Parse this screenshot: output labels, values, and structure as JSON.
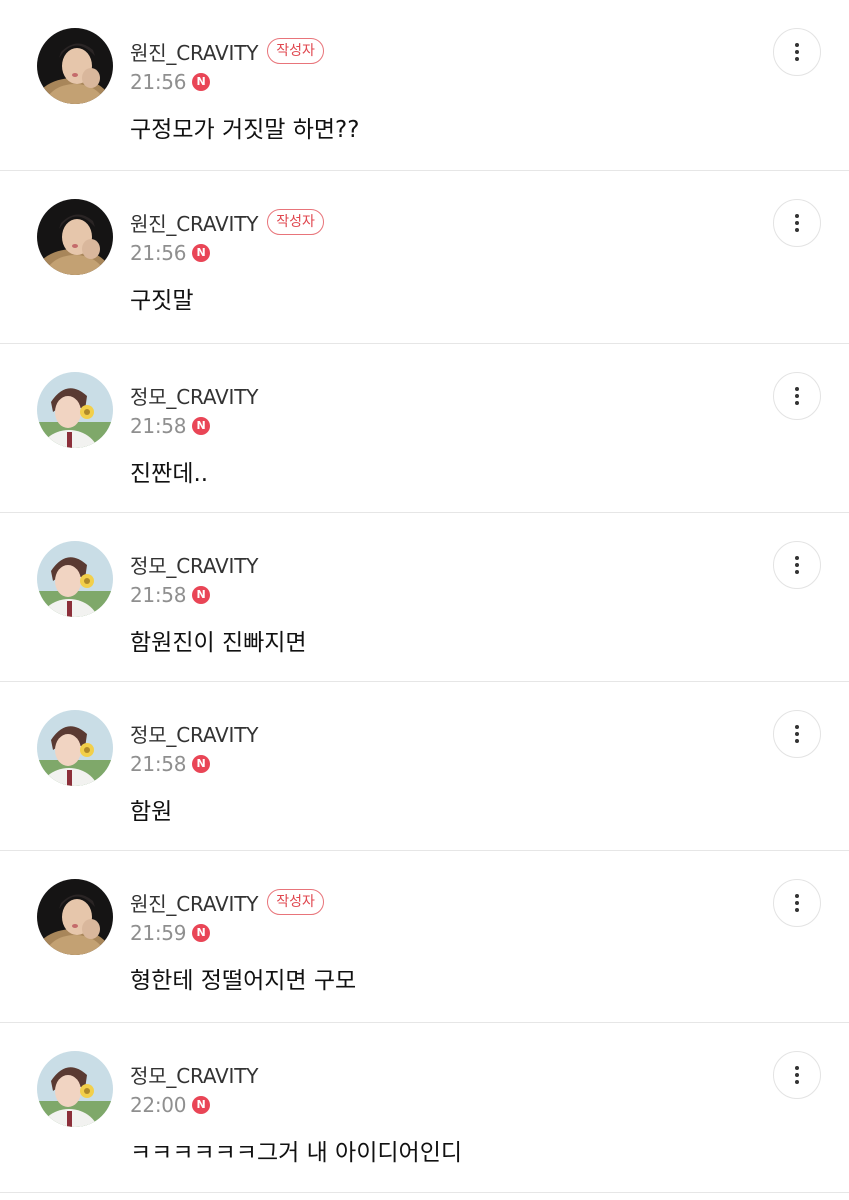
{
  "comments": [
    {
      "author": "원진_CRAVITY",
      "badge": "작성자",
      "time": "21:56",
      "new_badge": "N",
      "text": "구정모가 거짓말 하면??",
      "avatar": "wonjin"
    },
    {
      "author": "원진_CRAVITY",
      "badge": "작성자",
      "time": "21:56",
      "new_badge": "N",
      "text": "구짓말",
      "avatar": "wonjin"
    },
    {
      "author": "정모_CRAVITY",
      "badge": "",
      "time": "21:58",
      "new_badge": "N",
      "text": "진짠데..",
      "avatar": "jungmo"
    },
    {
      "author": "정모_CRAVITY",
      "badge": "",
      "time": "21:58",
      "new_badge": "N",
      "text": "함원진이 진빠지면",
      "avatar": "jungmo"
    },
    {
      "author": "정모_CRAVITY",
      "badge": "",
      "time": "21:58",
      "new_badge": "N",
      "text": "함원",
      "avatar": "jungmo"
    },
    {
      "author": "원진_CRAVITY",
      "badge": "작성자",
      "time": "21:59",
      "new_badge": "N",
      "text": "형한테 정떨어지면 구모",
      "avatar": "wonjin"
    },
    {
      "author": "정모_CRAVITY",
      "badge": "",
      "time": "22:00",
      "new_badge": "N",
      "text": "ㅋㅋㅋㅋㅋㅋ그거 내 아이디어인디",
      "avatar": "jungmo"
    }
  ],
  "colors": {
    "badge_border": "#e8747a",
    "badge_text": "#e0474f",
    "new_badge_bg": "#e94556",
    "divider": "#e6e6e6",
    "time_text": "#8f8f8f"
  },
  "icons": {
    "more": "vertical-ellipsis-icon",
    "new": "new-n-icon"
  }
}
